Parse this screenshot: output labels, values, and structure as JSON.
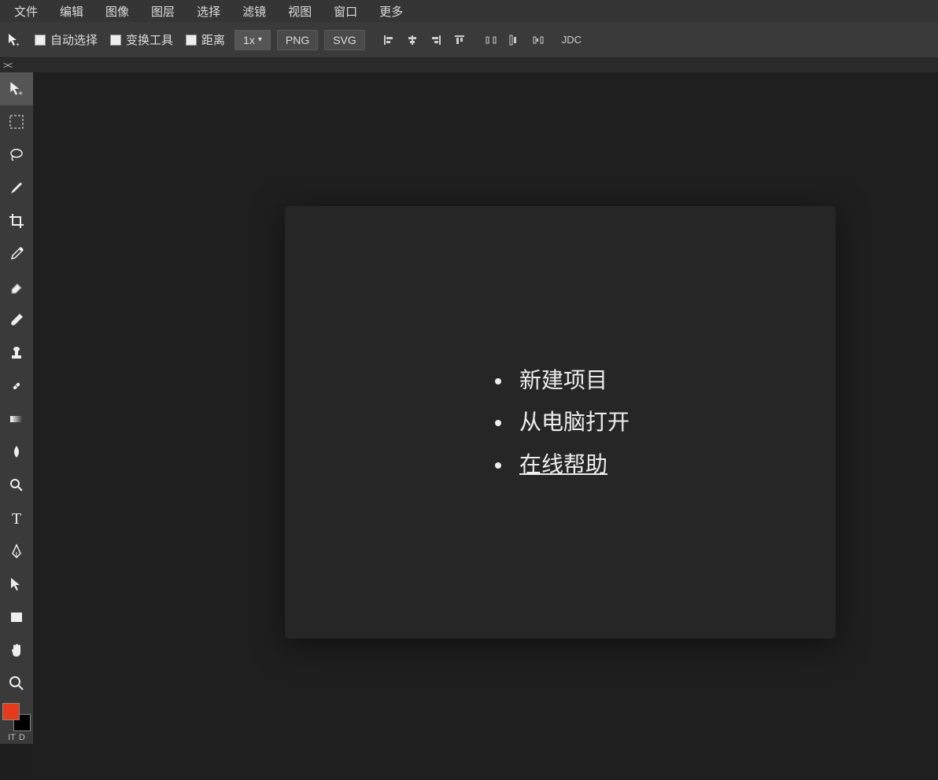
{
  "menubar": [
    "文件",
    "编辑",
    "图像",
    "图层",
    "选择",
    "滤镜",
    "视图",
    "窗口",
    "更多"
  ],
  "toolbar": {
    "auto_select": "自动选择",
    "transform": "变换工具",
    "distance": "距离",
    "zoom": "1x",
    "png": "PNG",
    "svg": "SVG",
    "jdc": "JDC"
  },
  "tools": [
    {
      "name": "move-tool",
      "icon": "move"
    },
    {
      "name": "marquee-tool",
      "icon": "marquee"
    },
    {
      "name": "lasso-tool",
      "icon": "lasso"
    },
    {
      "name": "brush-tool",
      "icon": "brush"
    },
    {
      "name": "crop-tool",
      "icon": "crop"
    },
    {
      "name": "eyedropper-tool",
      "icon": "eyedropper"
    },
    {
      "name": "eraser-tool",
      "icon": "eraser"
    },
    {
      "name": "paint-brush-tool",
      "icon": "paintbrush"
    },
    {
      "name": "stamp-tool",
      "icon": "stamp"
    },
    {
      "name": "healing-tool",
      "icon": "healing"
    },
    {
      "name": "gradient-tool",
      "icon": "gradient"
    },
    {
      "name": "blur-tool",
      "icon": "blur"
    },
    {
      "name": "dodge-tool",
      "icon": "dodge"
    },
    {
      "name": "text-tool",
      "icon": "text"
    },
    {
      "name": "pen-tool",
      "icon": "pen"
    },
    {
      "name": "path-select-tool",
      "icon": "pathselect"
    },
    {
      "name": "shape-tool",
      "icon": "shape"
    },
    {
      "name": "hand-tool",
      "icon": "hand"
    },
    {
      "name": "zoom-tool",
      "icon": "zoom"
    }
  ],
  "colors": {
    "foreground": "#e63b1a",
    "background": "#000000",
    "mini_left": "IT",
    "mini_right": "D"
  },
  "welcome": {
    "items": [
      {
        "label": "新建项目",
        "link": false
      },
      {
        "label": "从电脑打开",
        "link": false
      },
      {
        "label": "在线帮助",
        "link": true
      }
    ]
  }
}
